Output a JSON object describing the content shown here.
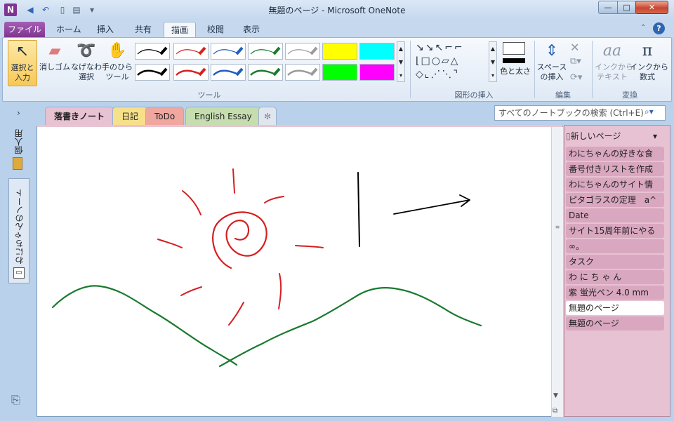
{
  "window": {
    "title": "無題のページ - Microsoft OneNote",
    "min_glyph": "—",
    "max_glyph": "□",
    "close_glyph": "✕"
  },
  "ribbon_tabs": [
    "ファイル",
    "ホーム",
    "挿入",
    "共有",
    "描画",
    "校閲",
    "表示"
  ],
  "active_tab": "描画",
  "ribbon": {
    "select_label": "選択と\n入力",
    "eraser_label": "消しゴム",
    "lasso_label": "なげなわ\n選択",
    "pan_label": "手のひら\nツール",
    "tools_group": "ツール",
    "insert_shapes_group": "図形の挿入",
    "color_width_label": "色と太さ",
    "insert_space_label": "スペース\nの挿入",
    "edit_group": "編集",
    "ink_to_text_label": "インクから\nテキスト",
    "ink_to_math_label": "インクから\n数式",
    "convert_group": "変換",
    "pen_colors": [
      "#000000",
      "#d42020",
      "#1f5fbf",
      "#1a7a2e",
      "#9a9a9a"
    ],
    "highlighter_colors": [
      "#ffff00",
      "#00ffff",
      "#00ff00",
      "#ff00ff"
    ]
  },
  "notebook_tabs": [
    {
      "label": "落書きノート",
      "color": "#e7c2d2"
    },
    {
      "label": "日記",
      "color": "#f6e08a"
    },
    {
      "label": "ToDo",
      "color": "#f0a7a0"
    },
    {
      "label": "English Essay",
      "color": "#c6ddb0"
    }
  ],
  "search": {
    "placeholder": "すべてのノートブックの検索 (Ctrl+E)"
  },
  "sidebar": {
    "notebook_personal": "個人用",
    "notebook_wani": "わにちゃんのノート"
  },
  "pages_panel": {
    "new_page": "新しいページ",
    "pages": [
      "わにちゃんの好きな食",
      "番号付きリストを作成",
      "わにちゃんのサイト情",
      "ピタゴラスの定理　a^",
      "Date",
      "サイト15周年前にやる",
      "∞。",
      "タスク",
      "わ に ち ゃ ん",
      "紫 蛍光ペン 4.0 mm",
      "無題のページ",
      "無題のページ"
    ],
    "active_index": 10
  },
  "colors": {
    "sun_stroke": "#d42020",
    "hill_stroke": "#1a7a2e",
    "line_stroke": "#000000"
  }
}
